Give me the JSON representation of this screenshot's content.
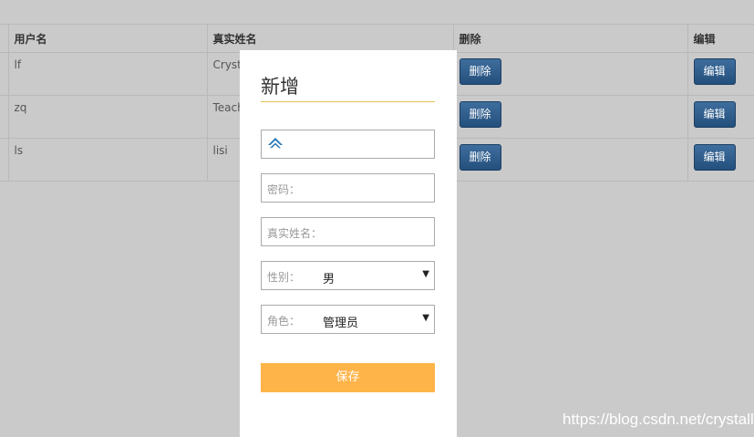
{
  "table": {
    "headers": [
      "用户名",
      "真实姓名",
      "删除",
      "编辑"
    ],
    "rows": [
      {
        "username": "lf",
        "realname": "Cryst",
        "delete_label": "删除",
        "edit_label": "编辑"
      },
      {
        "username": "zq",
        "realname": "Teach",
        "delete_label": "删除",
        "edit_label": "编辑"
      },
      {
        "username": "ls",
        "realname": "lisi",
        "delete_label": "删除",
        "edit_label": "编辑"
      }
    ]
  },
  "modal": {
    "title": "新增",
    "username_icon": "home-icon",
    "password_placeholder": "密码：",
    "realname_placeholder": "真实姓名：",
    "gender": {
      "label": "性别：",
      "value": "男"
    },
    "role": {
      "label": "角色：",
      "value": "管理员"
    },
    "save_label": "保存"
  },
  "colors": {
    "button_blue": "#2b5a8a",
    "save_orange": "#ffb44a",
    "overlay": "#cacaca"
  },
  "watermark": "https://blog.csdn.net/crystallf"
}
